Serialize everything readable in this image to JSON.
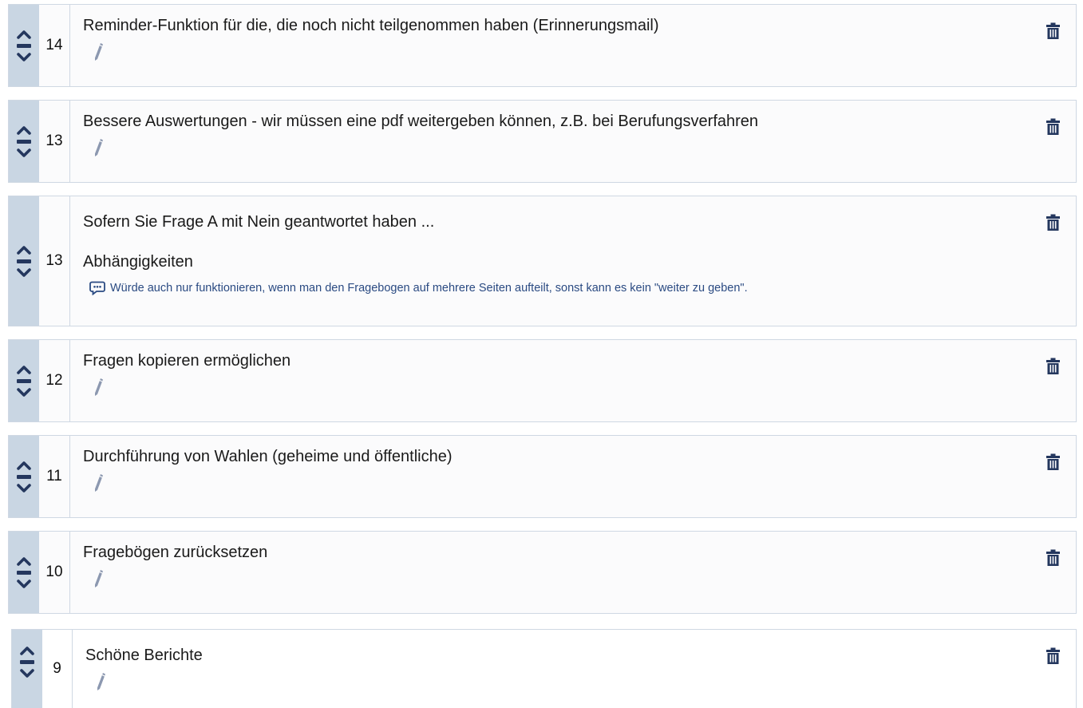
{
  "items": [
    {
      "votes": "14",
      "title": "Reminder-Funktion für die, die noch nicht teilgenommen haben (Erinnerungsmail)"
    },
    {
      "votes": "13",
      "title": "Bessere Auswertungen - wir müssen eine pdf weitergeben können, z.B. bei Berufungsverfahren"
    },
    {
      "votes": "13",
      "title": "Sofern Sie Frage A mit Nein geantwortet haben ...",
      "section": "Abhängigkeiten",
      "comment": "Würde auch nur funktionieren, wenn man den Fragebogen auf mehrere Seiten aufteilt, sonst kann es kein \"weiter zu geben\"."
    },
    {
      "votes": "12",
      "title": "Fragen kopieren ermöglichen"
    },
    {
      "votes": "11",
      "title": "Durchführung von Wahlen (geheime und öffentliche)"
    },
    {
      "votes": "10",
      "title": "Fragebögen zurücksetzen"
    },
    {
      "votes": "9",
      "title": "Schöne Berichte"
    }
  ],
  "icons": {
    "upvote": "chevron-up-icon",
    "neutral": "minus-icon",
    "downvote": "chevron-down-icon",
    "edit": "pencil-icon",
    "delete": "trash-icon",
    "comment": "comment-icon"
  },
  "colors": {
    "vote_column": "#c9d6e3",
    "icon_dark": "#24375e",
    "pencil": "#8c98b0",
    "comment_text": "#2a4a82",
    "border": "#cfd8e3"
  }
}
